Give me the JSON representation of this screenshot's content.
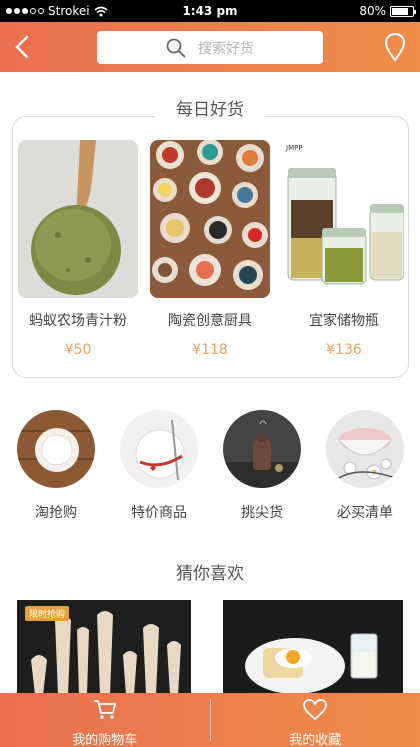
{
  "status_bar": {
    "carrier": "Strokei",
    "time": "1:43 pm",
    "battery": "80%",
    "battery_level": 0.8
  },
  "header": {
    "search_placeholder": "搜索好货"
  },
  "daily": {
    "title": "每日好货",
    "products": [
      {
        "name": "蚂蚁农场青汁粉",
        "price": "¥50"
      },
      {
        "name": "陶瓷创意厨具",
        "price": "¥118"
      },
      {
        "name": "宜家储物瓶",
        "price": "¥136",
        "image_label": "JMPP"
      }
    ]
  },
  "categories": [
    {
      "label": "淘抢购"
    },
    {
      "label": "特价商品"
    },
    {
      "label": "挑尖货"
    },
    {
      "label": "必买清单"
    }
  ],
  "guess": {
    "title": "猜你喜欢",
    "badge": "限时抢购"
  },
  "bottom_bar": {
    "cart_label": "我的购物车",
    "favorites_label": "我的收藏"
  },
  "colors": {
    "accent_start": "#e9704f",
    "accent_end": "#f08d4b",
    "price": "#f0a05d"
  }
}
